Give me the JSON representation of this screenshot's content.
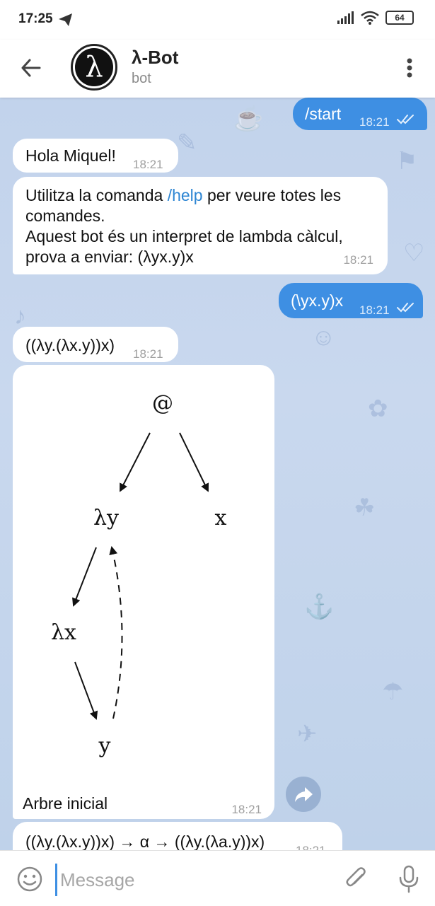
{
  "status_bar": {
    "time": "17:25",
    "battery": "64"
  },
  "header": {
    "title": "λ-Bot",
    "subtitle": "bot",
    "avatar_glyph": "λ"
  },
  "messages": [
    {
      "id": "m1",
      "direction": "out",
      "text": "/start",
      "time": "18:21"
    },
    {
      "id": "m2",
      "direction": "in",
      "text": "Hola Miquel!",
      "time": "18:21"
    },
    {
      "id": "m3",
      "direction": "in",
      "text_before_link": "Utilitza la comanda ",
      "link": "/help",
      "text_after_link": " per veure totes les comandes.",
      "text_line2": "Aquest bot és un interpret de lambda càlcul, prova a enviar: (λyx.y)x",
      "time": "18:21"
    },
    {
      "id": "m4",
      "direction": "out",
      "text": "(\\yx.y)x",
      "time": "18:21"
    },
    {
      "id": "m5",
      "direction": "in",
      "text": "((λy.(λx.y))x)",
      "time": "18:21"
    },
    {
      "id": "m6",
      "direction": "in",
      "caption": "Arbre inicial",
      "time": "18:21",
      "tree_labels": {
        "root": "@",
        "left": "λy",
        "right": "x",
        "inner": "λx",
        "leaf": "y"
      }
    },
    {
      "id": "m7",
      "direction": "in",
      "text": "((λy.(λx.y))x) → α → ((λy.(λa.y))x)",
      "time": "18:21"
    }
  ],
  "input": {
    "placeholder": "Message"
  },
  "colors": {
    "outgoing": "#3e8fe3",
    "incoming": "#ffffff",
    "link": "#2e86d3",
    "chat_bg": "#c2d3ec"
  }
}
